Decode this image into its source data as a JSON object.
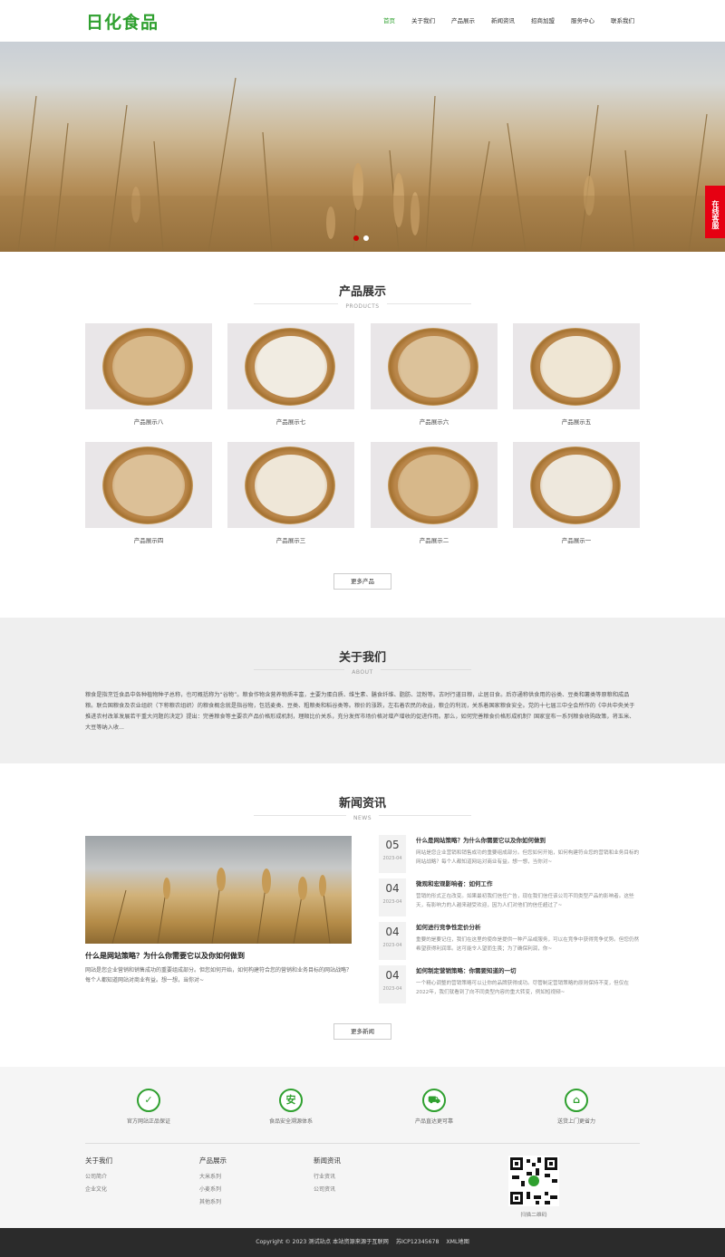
{
  "header": {
    "logo": "日化食品",
    "nav": [
      "首页",
      "关于我们",
      "产品展示",
      "新闻资讯",
      "招商加盟",
      "服务中心",
      "联系我们"
    ]
  },
  "banner": {
    "side_service": "在线客服"
  },
  "products": {
    "title": "产品展示",
    "subtitle": "PRODUCTS",
    "items": [
      {
        "name": "产品展示八",
        "grain": "#d8b98a"
      },
      {
        "name": "产品展示七",
        "grain": "#f1ece2"
      },
      {
        "name": "产品展示六",
        "grain": "#dcc29a"
      },
      {
        "name": "产品展示五",
        "grain": "#efe6d4"
      },
      {
        "name": "产品展示四",
        "grain": "#dcc097"
      },
      {
        "name": "产品展示三",
        "grain": "#efe7d8"
      },
      {
        "name": "产品展示二",
        "grain": "#d7b88a"
      },
      {
        "name": "产品展示一",
        "grain": "#eee8dd"
      }
    ],
    "more": "更多产品"
  },
  "about": {
    "title": "关于我们",
    "subtitle": "ABOUT",
    "text": "粮食是指烹饪食品中各种植物种子总称，也可概括称为“谷物”。粮食作物含营养物质丰富，主要为蛋白质、维生素、膳食纤维、脂肪、淀粉等。古时行道日粮，止居日食。后亦通称供食用的谷类、豆类和薯类等原粮和成品粮。联合国粮食及农业组织（下称粮农组织）的粮食概念就是指谷物，包括麦类、豆类、粗粮类和稻谷类等。粮价的涨跌，左右着农民的收益，粮企的利润，关系着国家粮食安全。党的十七届三中全会所作的《中共中央关于推进农村改革发展若干重大问题的决定》提出：完善粮食等主要农产品价格形成机制，理顺比价关系，充分发挥市场价格对增产增收的促进作用。那么，如何完善粮食价格形成机制？国家宣布一系列粮食收购政策，将玉米、大豆等纳入收..."
  },
  "news": {
    "title": "新闻资讯",
    "subtitle": "NEWS",
    "main": {
      "title": "什么是网站策略？为什么你需要它以及你如何做到",
      "desc": "网站是您企业营销和销售成功的重要组成部分。但您如何开始，如何构建符合您的营销和业务目标的网站战略？每个人都知道网站对商业有益。想一想，当你对~"
    },
    "items": [
      {
        "day": "05",
        "ym": "2023-04",
        "title": "什么是网站策略？为什么你需要它以及你如何做到",
        "desc": "网站是您企业营销和销售成功的重要组成部分。但您如何开始，如何构建符合您的营销和业务目标的网站战略？每个人都知道网站对商业有益。想一想，当你对~"
      },
      {
        "day": "04",
        "ym": "2023-04",
        "title": "微观和宏观影响者：如何工作",
        "desc": "营销的形式正在改变。如果最初我们信任广告，现在我们信任该公司不同类型产品的影响者。这些天，有影响力的人越来越受欢迎，因为人们对他们的信任超过了~"
      },
      {
        "day": "04",
        "ym": "2023-04",
        "title": "如何进行竞争性定价分析",
        "desc": "重要的是要记住，我们在这里的使命是提供一种产品或服务，可以在竞争中获得竞争优势。但您仍然希望获得利润率。这可能令人望而生畏；为了确保利润，你~"
      },
      {
        "day": "04",
        "ym": "2023-04",
        "title": "如何制定营销策略：你需要知道的一切",
        "desc": "一个精心调整的营销策略可以让你的品牌获得成功。尽管制定营销策略的原则保持不变，但仅在2022年，我们就看到了向不同类型内容的重大转变，例如短视频~"
      }
    ],
    "more": "更多新闻"
  },
  "footer": {
    "features": [
      {
        "icon": "shield-icon",
        "glyph": "✓",
        "label": "官方网站正品保证"
      },
      {
        "icon": "safety-icon",
        "glyph": "安",
        "label": "食品安全溯源体系"
      },
      {
        "icon": "truck-icon",
        "glyph": "⛟",
        "label": "产品直达更可靠"
      },
      {
        "icon": "delivery-icon",
        "glyph": "⌂",
        "label": "送货上门更省力"
      }
    ],
    "columns": [
      {
        "heading": "关于我们",
        "links": [
          "公司简介",
          "企业文化"
        ]
      },
      {
        "heading": "产品展示",
        "links": [
          "大米系列",
          "小麦系列",
          "其他系列"
        ]
      },
      {
        "heading": "新闻资讯",
        "links": [
          "行业资讯",
          "公司资讯"
        ]
      }
    ],
    "qr_label": "扫描二维码",
    "copyright": "Copyright © 2023 测试站点 本站资源来源于互联网",
    "icp": "苏ICP12345678",
    "sitemap": "XML地图"
  },
  "colors": {
    "brand": "#2fa02f",
    "service": "#e60012",
    "footer_bar": "#2b2b2b"
  }
}
